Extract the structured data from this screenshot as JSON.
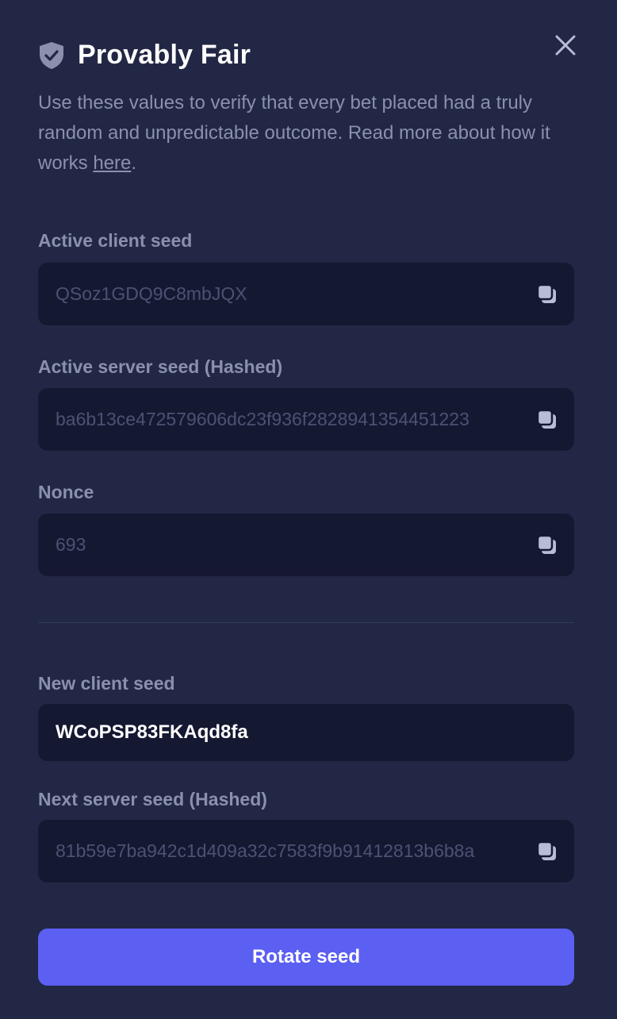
{
  "header": {
    "title": "Provably Fair",
    "icon": "shield-check-icon",
    "close_icon": "close-icon"
  },
  "description": {
    "text_before": "Use these values to verify that every bet placed had a truly random and unpredictable outcome. Read more about how it works ",
    "link_text": "here",
    "text_after": "."
  },
  "fields": {
    "active_client_seed": {
      "label": "Active client seed",
      "value": "QSoz1GDQ9C8mbJQX"
    },
    "active_server_seed": {
      "label": "Active server seed (Hashed)",
      "value": "ba6b13ce472579606dc23f936f2828941354451223"
    },
    "nonce": {
      "label": "Nonce",
      "value": "693"
    },
    "new_client_seed": {
      "label": "New client seed",
      "value": "WCoPSP83FKAqd8fa"
    },
    "next_server_seed": {
      "label": "Next server seed (Hashed)",
      "value": "81b59e7ba942c1d409a32c7583f9b91412813b6b8a"
    }
  },
  "actions": {
    "rotate_label": "Rotate seed"
  },
  "colors": {
    "background": "#212744",
    "field_bg": "#151831",
    "accent": "#5b5ff2",
    "muted_text": "#8a90ae"
  }
}
